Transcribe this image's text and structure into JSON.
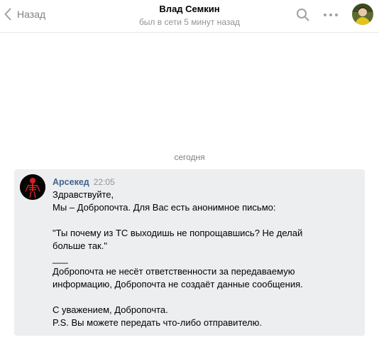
{
  "header": {
    "back_label": "Назад",
    "title": "Влад Семкин",
    "status": "был в сети 5 минут назад",
    "icons": [
      "chevron-left-icon",
      "search-icon",
      "more-icon",
      "avatar"
    ]
  },
  "date_separator": "сегодня",
  "message": {
    "author": "Арсекед",
    "time": "22:05",
    "lines": {
      "greeting": "Здравствуйте,",
      "intro": "Мы – Добропочта. Для Вас есть анонимное письмо:",
      "quote_1": "\"Ты почему из ТС выходишь не попрощавшись? Не делай",
      "quote_2": "больше так.\"",
      "divider": "___",
      "disclaimer_1": "Добропочта не несёт ответственности за передаваемую",
      "disclaimer_2": "информацию, Добропочта не создаёт данные сообщения.",
      "signoff": "С уважением, Добропочта.",
      "ps": "P.S. Вы можете передать что-либо отправителю."
    }
  },
  "colors": {
    "author_link": "#42648b",
    "muted_text": "#828282",
    "message_bg": "#edeef0",
    "icon_gray": "#99a2ad"
  }
}
